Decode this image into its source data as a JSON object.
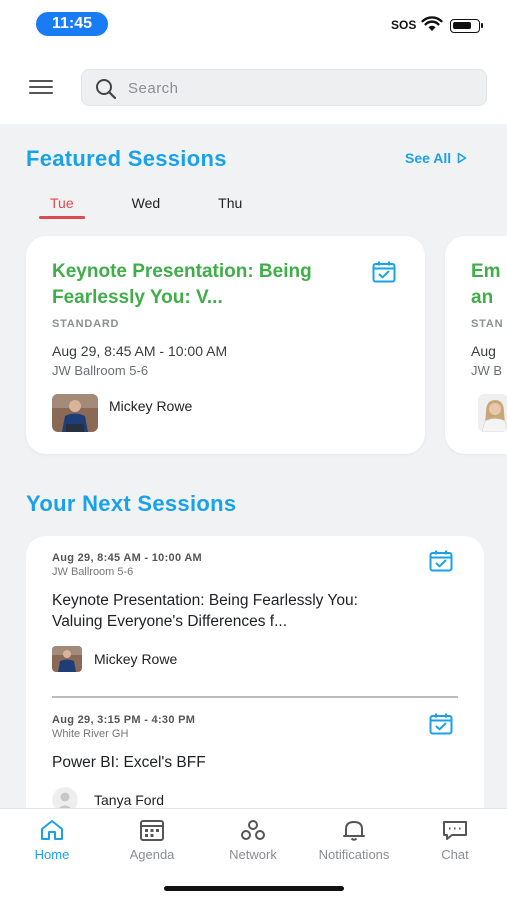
{
  "status_bar": {
    "time": "11:45",
    "sos": "SOS",
    "battery_level": 0.8
  },
  "search": {
    "placeholder": "Search"
  },
  "featured": {
    "title": "Featured Sessions",
    "see_all": "See All",
    "days": [
      "Tue",
      "Wed",
      "Thu"
    ],
    "active_day": "Tue",
    "cards": [
      {
        "title": "Keynote Presentation: Being Fearlessly You: V...",
        "type": "STANDARD",
        "time": "Aug 29, 8:45 AM - 10:00 AM",
        "room": "JW Ballroom 5-6",
        "speaker": "Mickey Rowe"
      },
      {
        "title": "Em... an...",
        "title_lines": [
          "Em",
          "an"
        ],
        "type": "STAN",
        "time": "Aug",
        "room": "JW B",
        "speaker": ""
      }
    ]
  },
  "next": {
    "title": "Your Next Sessions",
    "sessions": [
      {
        "time": "Aug 29, 8:45 AM - 10:00 AM",
        "room": "JW Ballroom 5-6",
        "name": "Keynote Presentation: Being Fearlessly You: Valuing Everyone's Differences f...",
        "speaker": "Mickey Rowe"
      },
      {
        "time": "Aug 29, 3:15 PM - 4:30 PM",
        "room": "White River GH",
        "name": "Power BI: Excel's BFF",
        "speaker": "Tanya Ford"
      }
    ]
  },
  "nav": {
    "items": [
      {
        "label": "Home",
        "icon": "home-icon",
        "active": true
      },
      {
        "label": "Agenda",
        "icon": "agenda-icon",
        "active": false
      },
      {
        "label": "Network",
        "icon": "network-icon",
        "active": false
      },
      {
        "label": "Notifications",
        "icon": "bell-icon",
        "active": false
      },
      {
        "label": "Chat",
        "icon": "chat-icon",
        "active": false
      }
    ]
  },
  "colors": {
    "accent": "#1aa2e8",
    "featured_title": "#3fae49",
    "active_tab": "#e0484f",
    "time_pill": "#1a7cf5"
  }
}
